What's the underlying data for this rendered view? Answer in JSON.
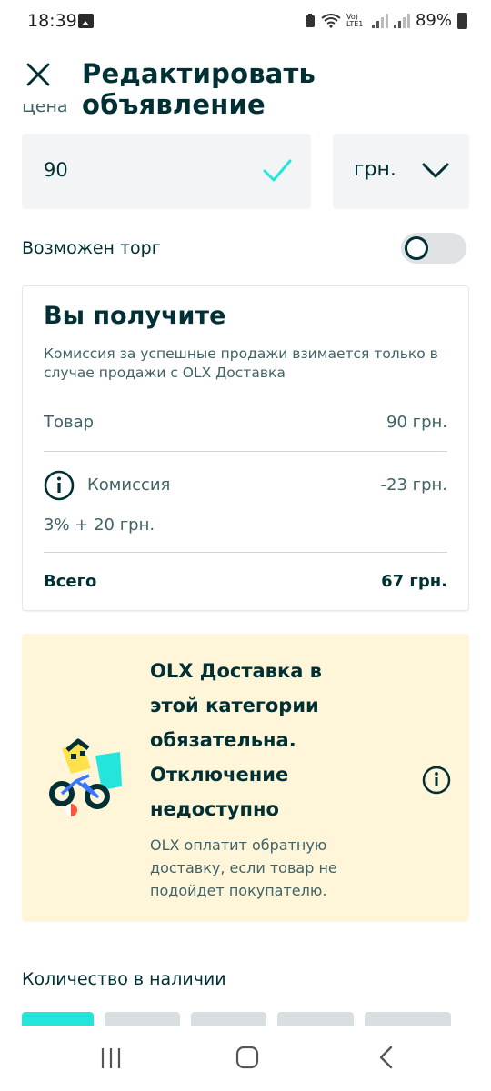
{
  "status_bar": {
    "time": "18:39",
    "network": "Vo) LTE1",
    "battery": "89%"
  },
  "header": {
    "title": "Редактировать объявление"
  },
  "price_section": {
    "label": "Цена",
    "value": "90",
    "currency": "грн."
  },
  "bargain": {
    "label": "Возможен торг",
    "enabled": false
  },
  "receive_card": {
    "title": "Вы получите",
    "note": "Комиссия за успешные продажи взимается только в случае продажи с OLX Доставка",
    "item_label": "Товар",
    "item_value": "90 грн.",
    "commission_label": "Комиссия",
    "commission_value": "-23 грн.",
    "commission_formula": "3% + 20 грн.",
    "total_label": "Всего",
    "total_value": "67 грн."
  },
  "delivery_banner": {
    "title": "OLX Доставка в этой категории обязательна. Отключение недоступно",
    "description": "OLX оплатит обратную доставку, если товар не подойдет покупателю."
  },
  "quantity": {
    "label": "Количество в наличии"
  },
  "colors": {
    "brand_dark": "#002f34",
    "accent_teal": "#23e5db",
    "banner_bg": "#fff6d9",
    "input_bg": "#f2f4f5"
  }
}
